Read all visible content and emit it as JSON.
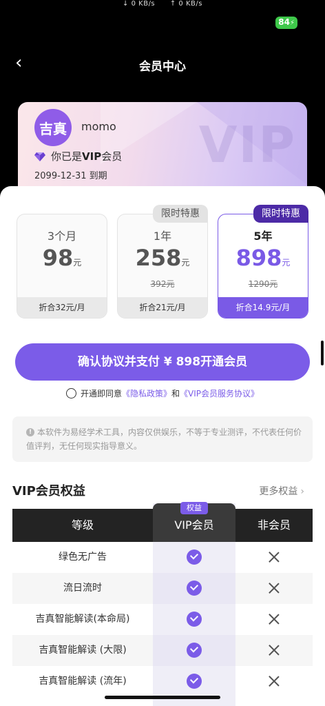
{
  "status": {
    "down_speed": "↓ 0 KB/s",
    "up_speed": "↑ 0 KB/s",
    "battery": "84"
  },
  "nav": {
    "back_icon": "‹",
    "title": "会员中心"
  },
  "member": {
    "avatar_text": "吉真",
    "username": "momo",
    "status_prefix": "你已是",
    "status_vip": "VIP",
    "status_suffix": "会员",
    "expire": "2099-12-31 到期",
    "watermark": "VIP"
  },
  "plans": [
    {
      "name": "3个月",
      "price": "98",
      "unit": "元",
      "original": "",
      "per_month": "折合32元/月",
      "badge": ""
    },
    {
      "name": "1年",
      "price": "258",
      "unit": "元",
      "original": "392元",
      "per_month": "折合21元/月",
      "badge": "限时特惠"
    },
    {
      "name": "5年",
      "price": "898",
      "unit": "元",
      "original": "1290元",
      "per_month": "折合14.9元/月",
      "badge": "限时特惠"
    }
  ],
  "pay_button": "确认协议并支付 ¥ 898开通会员",
  "agreement": {
    "prefix": "开通即同意",
    "privacy": "《隐私政策》",
    "and": "和",
    "service": "《VIP会员服务协议》"
  },
  "disclaimer": "本软件为易经学术工具，内容仅供娱乐，不等于专业测评，不代表任何价值评判，无任何现实指导意义。",
  "benefits": {
    "title": "VIP会员权益",
    "more": "更多权益",
    "tag": "权益",
    "headers": [
      "等级",
      "VIP会员",
      "非会员"
    ],
    "rows": [
      "绿色无广告",
      "流日流时",
      "吉真智能解读(本命局)",
      "吉真智能解读 (大限)",
      "吉真智能解读 (流年)"
    ]
  },
  "colors": {
    "accent": "#7b5ce8",
    "badge_dark": "#4c2aa6",
    "battery": "#3ec84a"
  },
  "icons": {
    "back": "chevron-left-icon",
    "gem": "gem-icon",
    "info": "info-icon",
    "check": "check-circle-icon",
    "cross": "x-icon",
    "more": "chevron-right-icon"
  }
}
